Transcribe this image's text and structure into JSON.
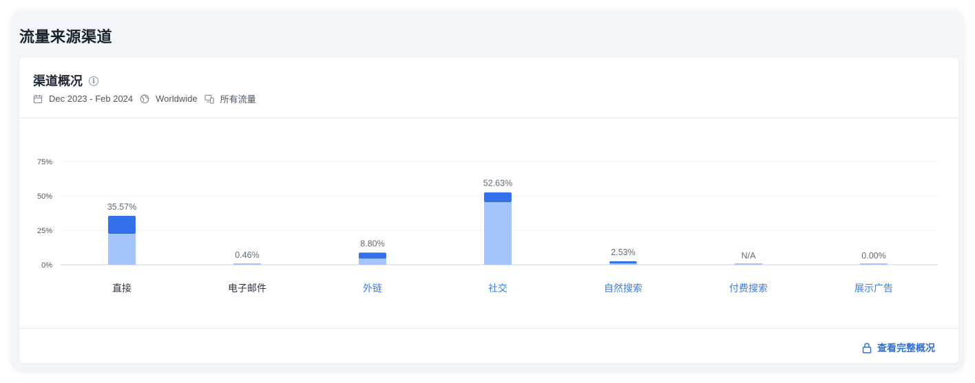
{
  "header": {
    "title": "流量来源渠道"
  },
  "card": {
    "title": "渠道概况",
    "meta": {
      "date_range": "Dec 2023 - Feb 2024",
      "region": "Worldwide",
      "traffic": "所有流量"
    }
  },
  "chart_data": {
    "type": "bar",
    "stacked": true,
    "categories": [
      "直接",
      "电子邮件",
      "外链",
      "社交",
      "自然搜索",
      "付费搜索",
      "展示广告"
    ],
    "category_is_link": [
      false,
      false,
      true,
      true,
      true,
      true,
      true
    ],
    "value_labels": [
      "35.57%",
      "0.46%",
      "8.80%",
      "52.63%",
      "2.53%",
      "N/A",
      "0.00%"
    ],
    "totals": [
      35.57,
      0.46,
      8.8,
      52.63,
      2.53,
      0,
      0.0
    ],
    "series": [
      {
        "color": "#a3c4fd",
        "values": [
          22.5,
          0.46,
          4.5,
          45.5,
          1.0,
          0,
          0
        ]
      },
      {
        "color": "#3371ea",
        "values": [
          13.07,
          0,
          4.3,
          7.13,
          1.53,
          0,
          0
        ]
      }
    ],
    "y_ticks": [
      "0%",
      "25%",
      "50%",
      "75%"
    ],
    "ylim": [
      0,
      75
    ],
    "grid": true
  },
  "footer": {
    "link_label": "查看完整概况"
  },
  "colors": {
    "accent": "#2d6fde",
    "bar_light": "#a3c4fd",
    "bar_dark": "#3371ea"
  }
}
